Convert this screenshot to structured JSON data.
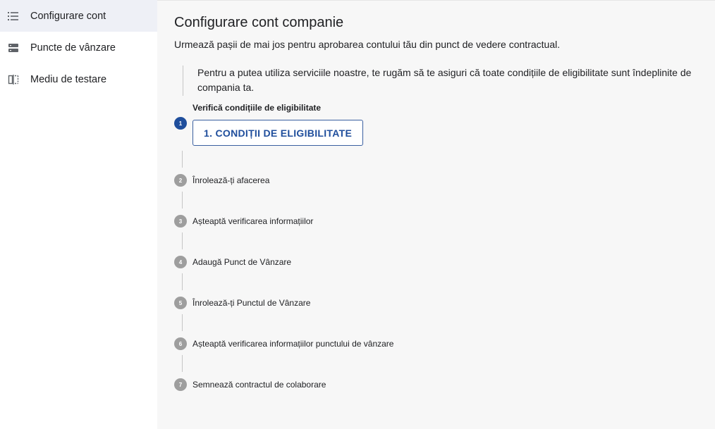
{
  "sidebar": {
    "items": [
      {
        "label": "Configurare cont",
        "icon": "list-icon"
      },
      {
        "label": "Puncte de vânzare",
        "icon": "storage-icon"
      },
      {
        "label": "Mediu de testare",
        "icon": "split-view-icon"
      }
    ]
  },
  "main": {
    "title": "Configurare cont companie",
    "subtitle": "Urmează pașii de mai jos pentru aprobarea contului tău din punct de vedere contractual.",
    "info": "Pentru a putea utiliza serviciile noastre, te rugăm să te asiguri că toate condițiile de eligibilitate sunt îndeplinite de compania ta.",
    "steps": [
      {
        "number": "1",
        "label": "Verifică condițiile de eligibilitate",
        "button": "1. CONDIȚII DE ELIGIBILITATE"
      },
      {
        "number": "2",
        "label": "Înrolează-ți afacerea"
      },
      {
        "number": "3",
        "label": "Așteaptă verificarea informațiilor"
      },
      {
        "number": "4",
        "label": "Adaugă Punct de Vânzare"
      },
      {
        "number": "5",
        "label": "Înrolează-ți Punctul de Vânzare"
      },
      {
        "number": "6",
        "label": "Așteaptă verificarea informațiilor punctului de vânzare"
      },
      {
        "number": "7",
        "label": "Semnează contractul de colaborare"
      }
    ]
  },
  "colors": {
    "accent": "#1f4e9c",
    "inactive_step": "#9e9e9e",
    "active_nav_bg": "#eef0f6",
    "content_bg": "#f7f7f7"
  }
}
